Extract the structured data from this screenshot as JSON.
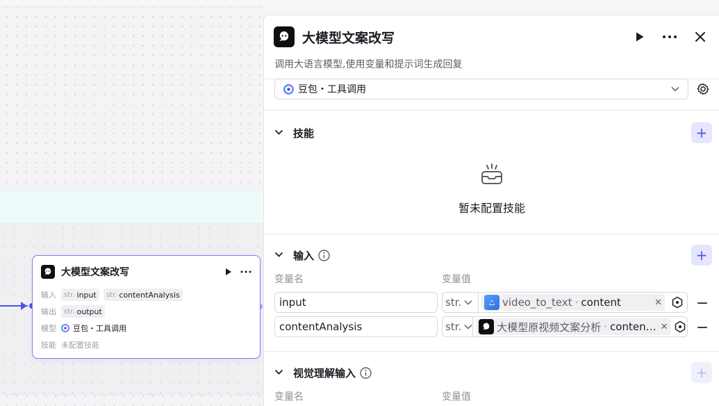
{
  "canvas": {
    "node": {
      "title": "大模型文案改写",
      "input_key": "输入",
      "output_key": "输出",
      "model_key": "模型",
      "skill_key": "技能",
      "type_prefix": "str.",
      "inputs": [
        "input",
        "contentAnalysis"
      ],
      "outputs": [
        "output"
      ],
      "model": "豆包・工具调用",
      "skill_value": "未配置技能"
    }
  },
  "panel": {
    "title": "大模型文案改写",
    "description": "调用大语言模型,使用变量和提示词生成回复",
    "model_select": {
      "value": "豆包・工具调用"
    },
    "skills": {
      "title": "技能",
      "empty_text": "暂未配置技能"
    },
    "inputs": {
      "title": "输入",
      "col_name": "变量名",
      "col_value": "变量值",
      "rows": [
        {
          "name": "input",
          "type": "str.",
          "node": "video_to_text",
          "field": "content"
        },
        {
          "name": "contentAnalysis",
          "type": "str.",
          "node": "大模型原视频文案分析",
          "field": "conten…"
        }
      ]
    },
    "vision_inputs": {
      "title": "视觉理解输入",
      "col_name": "变量名",
      "col_value": "变量值"
    }
  },
  "colors": {
    "accent": "#4d53e8",
    "accent_light": "#e5e6fd",
    "node_border": "#7c80f1"
  }
}
